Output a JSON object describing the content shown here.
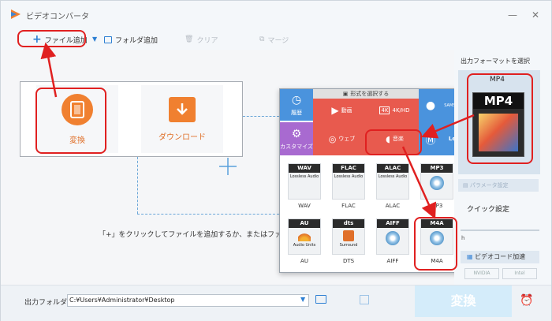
{
  "app": {
    "title": "ビデオコンバータ",
    "minimize": "—",
    "close": "✕"
  },
  "toolbar": {
    "add_file": "ファイル追加",
    "add_folder": "フォルダ追加",
    "clear": "クリア",
    "merge": "マージ"
  },
  "main": {
    "convert_label": "変換",
    "download_label": "ダウンロード",
    "hint": "「+」をクリックしてファイルを追加するか、またはファイルを"
  },
  "popup": {
    "title": "形式を選択する",
    "categories": {
      "history": "履歴",
      "video": "動画",
      "hd": "4K/HD",
      "web": "ウェブ",
      "audio": "音楽",
      "custom": "カスタマイズ",
      "samsung": "SAMSUNG",
      "lenovo": "Len"
    },
    "formats": [
      {
        "header": "WAV",
        "sub": "Lossless Audio",
        "label": "WAV"
      },
      {
        "header": "FLAC",
        "sub": "Lossless Audio",
        "label": "FLAC"
      },
      {
        "header": "ALAC",
        "sub": "Lossless Audio",
        "label": "ALAC"
      },
      {
        "header": "MP3",
        "sub": "",
        "label": "MP3"
      },
      {
        "header": "AU",
        "sub": "Audio Units",
        "label": "AU"
      },
      {
        "header": "dts",
        "sub": "Surround",
        "label": "DTS"
      },
      {
        "header": "AIFF",
        "sub": "",
        "label": "AIFF"
      },
      {
        "header": "M4A",
        "sub": "",
        "label": "M4A"
      }
    ]
  },
  "right": {
    "output_format_label": "出力フォーマットを選択",
    "format_name": "MP4",
    "format_badge": "MP4",
    "param_settings": "パラメータ設定",
    "quick_settings": "クイック設定",
    "slider_label": "h",
    "accel_label": "ビデオコード加速",
    "nvidia": "NVIDIA",
    "intel": "Intel"
  },
  "bottom": {
    "folder_label": "出力フォルダ：",
    "folder_path": "C:¥Users¥Administrator¥Desktop",
    "convert": "変換"
  },
  "colors": {
    "accent_orange": "#f08030",
    "video_red": "#e85a4e",
    "purple": "#a86ad0",
    "blue": "#3f88d6",
    "annotation_red": "#e02020"
  }
}
